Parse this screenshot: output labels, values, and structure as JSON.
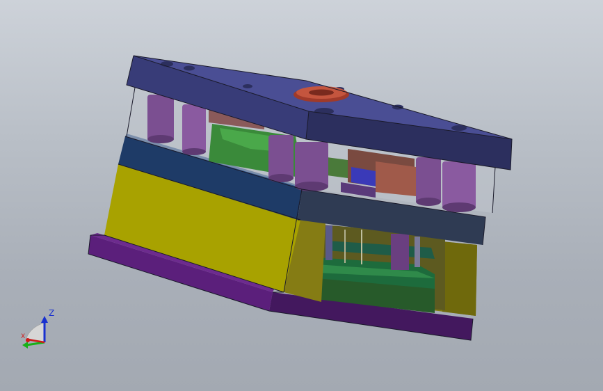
{
  "viewport": {
    "background_top": "#cdd2d9",
    "background_bottom": "#a3a9b2"
  },
  "model": {
    "parts": [
      "top-clamp-plate",
      "guide-pillars",
      "cavity-plate",
      "core-plate",
      "spacer-blocks",
      "ejector-plates",
      "bottom-clamp-plate",
      "locating-ring"
    ],
    "colors": {
      "top_plate": "#3b3f7e",
      "cavity_plate": "#1c3a66",
      "yellow_block": "#a8a200",
      "bottom_plate": "#5a1f7a",
      "pillars": "#7b4f91",
      "locating_ring": "#b0402e"
    }
  },
  "triad": {
    "z_label": "Z",
    "x_label": "X",
    "x_color": "#d01818",
    "y_color": "#18b018",
    "z_color": "#1830d0"
  }
}
